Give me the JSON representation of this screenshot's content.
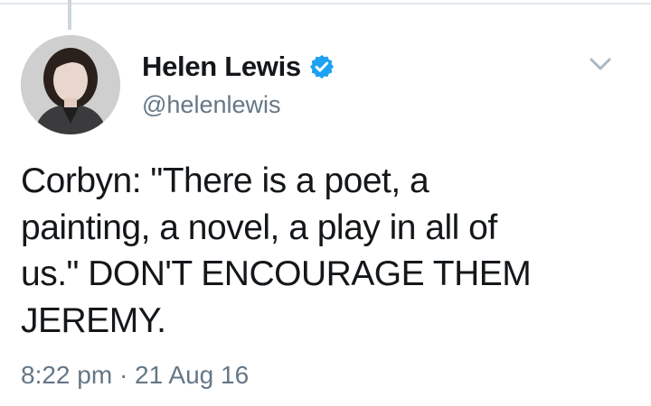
{
  "tweet": {
    "author": {
      "display_name": "Helen Lewis",
      "handle": "@helenlewis",
      "verified": true,
      "avatar_icon": "profile-photo"
    },
    "text": "Corbyn: \"There is a poet, a\npainting, a novel, a play in all of\nus.\" DON'T ENCOURAGE THEM\nJEREMY.",
    "timestamp": "8:22 pm · 21 Aug 16",
    "menu_icon": "chevron-down-icon"
  },
  "colors": {
    "text_primary": "#14171a",
    "text_secondary": "#657786",
    "verified_blue": "#1da1f2",
    "divider": "#e1e8ed",
    "thread_line": "#ccd6dd"
  }
}
